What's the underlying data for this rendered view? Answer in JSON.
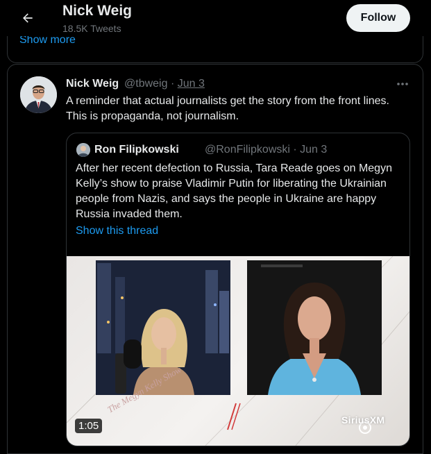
{
  "header": {
    "title": "Nick Weig",
    "tweet_count": "18.5K Tweets",
    "follow_label": "Follow",
    "show_more": "Show more"
  },
  "tweet": {
    "name": "Nick Weig",
    "handle": "@tbweig",
    "separator": "·",
    "date": "Jun 3",
    "text": "A reminder that actual journalists get the story from the front lines. This is propaganda, not journalism."
  },
  "quoted": {
    "name": "Ron Filipkowski",
    "handle": "@RonFilipkowski · Jun 3",
    "text": "After her recent defection to Russia, Tara Reade goes on Megyn Kelly’s show to praise Vladimir Putin for liberating the Ukrainian people from Nazis, and says the people in Ukraine are happy Russia invaded them.",
    "show_thread": "Show this thread",
    "video": {
      "duration": "1:05",
      "watermark": "SiriusXM",
      "show_logo": "The Megyn Kelly Show"
    }
  },
  "colors": {
    "accent": "#1d9bf0",
    "background": "#000000",
    "text_primary": "#e7e9ea",
    "text_secondary": "#71767b",
    "border": "#2f3336"
  },
  "icons": [
    "back-arrow-icon",
    "more-options-icon"
  ]
}
